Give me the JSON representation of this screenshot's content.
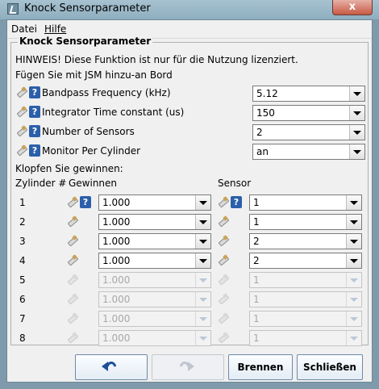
{
  "window": {
    "title": "Knock Sensorparameter",
    "close_glyph": "x"
  },
  "menu": [
    {
      "label": "Datei"
    },
    {
      "label": "Hilfe"
    }
  ],
  "group": {
    "title": "Knock Sensorparameter",
    "notice": "HINWEIS! Diese Funktion ist nur für die Nutzung lizenziert.",
    "notice2": "Fügen Sie mit JSM hinzu-an Bord"
  },
  "params": [
    {
      "label": "Bandpass Frequency (kHz)",
      "value": "5.12"
    },
    {
      "label": "Integrator Time constant (us)",
      "value": "150"
    },
    {
      "label": "Number of Sensors",
      "value": "2"
    },
    {
      "label": "Monitor Per Cylinder",
      "value": "an"
    }
  ],
  "gains_heading": "Klopfen Sie gewinnen:",
  "columns": {
    "cylinder": "Zylinder #",
    "gain": "Gewinnen",
    "sensor": "Sensor"
  },
  "help_glyph": "?",
  "cylinders": [
    {
      "num": "1",
      "gain": "1.000",
      "sensor": "1",
      "enabled": true
    },
    {
      "num": "2",
      "gain": "1.000",
      "sensor": "1",
      "enabled": true
    },
    {
      "num": "3",
      "gain": "1.000",
      "sensor": "2",
      "enabled": true
    },
    {
      "num": "4",
      "gain": "1.000",
      "sensor": "2",
      "enabled": true
    },
    {
      "num": "5",
      "gain": "1.000",
      "sensor": "1",
      "enabled": false
    },
    {
      "num": "6",
      "gain": "1.000",
      "sensor": "1",
      "enabled": false
    },
    {
      "num": "7",
      "gain": "1.000",
      "sensor": "1",
      "enabled": false
    },
    {
      "num": "8",
      "gain": "1.000",
      "sensor": "1",
      "enabled": false
    }
  ],
  "buttons": {
    "undo_icon": "undo-icon",
    "redo_icon": "redo-icon",
    "burn": "Brennen",
    "close": "Schließen"
  },
  "colors": {
    "title_bar": "#a7c2d0",
    "help_icon": "#2b5faa",
    "close_button": "#c85a45"
  }
}
